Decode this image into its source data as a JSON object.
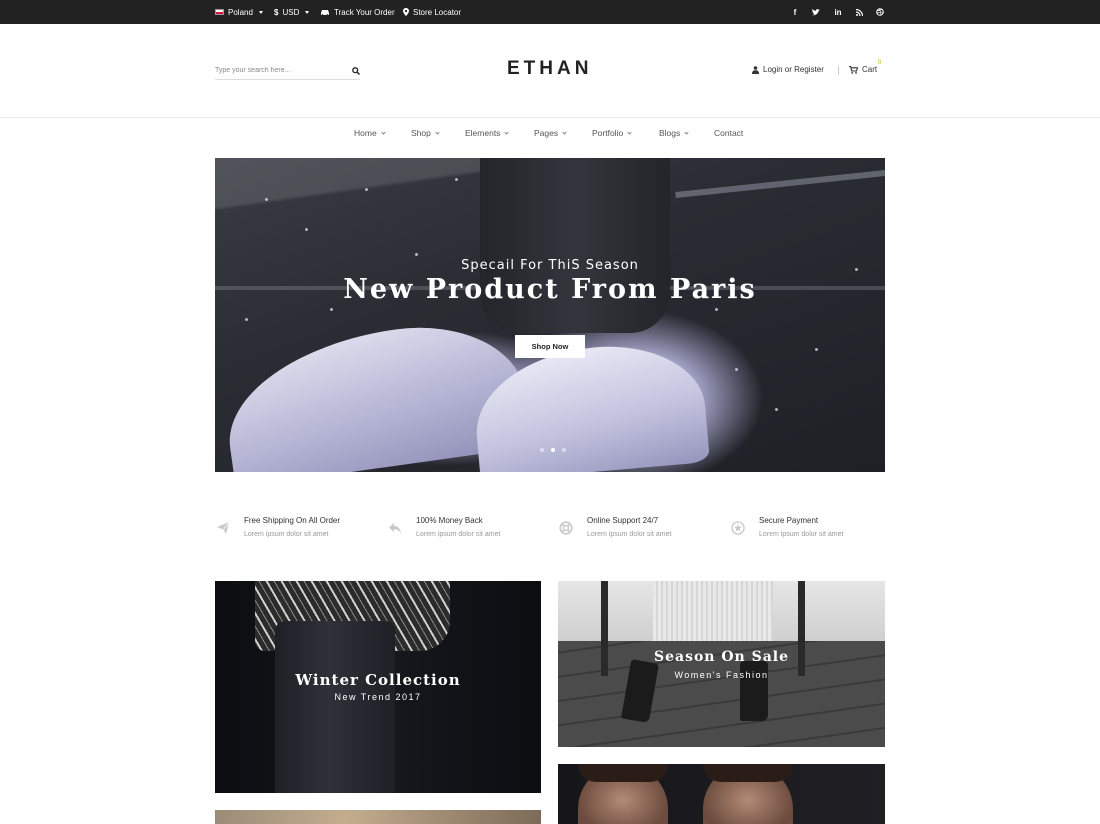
{
  "topbar": {
    "country": "Poland",
    "currency_symbol": "$",
    "currency": "USD",
    "track_order": "Track Your Order",
    "store_locator": "Store Locator",
    "social": [
      {
        "name": "facebook-icon",
        "glyph": "f"
      },
      {
        "name": "twitter-icon",
        "glyph": "t"
      },
      {
        "name": "linkedin-icon",
        "glyph": "in"
      },
      {
        "name": "rss-icon",
        "glyph": "rss"
      },
      {
        "name": "dribbble-icon",
        "glyph": "dr"
      }
    ]
  },
  "header": {
    "search_placeholder": "Type your search here...",
    "logo": "ETHAN",
    "login": "Login or Register",
    "cart": "Cart",
    "cart_count": "0"
  },
  "nav": {
    "items": [
      {
        "label": "Home",
        "dropdown": true
      },
      {
        "label": "Shop",
        "dropdown": true
      },
      {
        "label": "Elements",
        "dropdown": true
      },
      {
        "label": "Pages",
        "dropdown": true
      },
      {
        "label": "Portfolio",
        "dropdown": true
      },
      {
        "label": "Blogs",
        "dropdown": true
      },
      {
        "label": "Contact",
        "dropdown": false
      }
    ]
  },
  "hero": {
    "subtitle": "Specail For ThiS Season",
    "title": "New Product From Paris",
    "button": "Shop Now",
    "slide_count": 3,
    "active_slide": 2
  },
  "features": [
    {
      "icon": "plane-icon",
      "title": "Free Shipping On All Order",
      "desc": "Lorem ipsum dolor sit amet"
    },
    {
      "icon": "reply-arrow-icon",
      "title": "100% Money Back",
      "desc": "Lorem ipsum dolor sit amet"
    },
    {
      "icon": "lifebuoy-icon",
      "title": "Online Support 24/7",
      "desc": "Lorem ipsum dolor sit amet"
    },
    {
      "icon": "shield-star-icon",
      "title": "Secure Payment",
      "desc": "Lorem ipsum dolor sit amet"
    }
  ],
  "banners": {
    "winter": {
      "title": "Winter Collection",
      "subtitle": "New Trend 2017"
    },
    "sale": {
      "title": "Season On Sale",
      "subtitle": "Women's Fashion"
    }
  }
}
